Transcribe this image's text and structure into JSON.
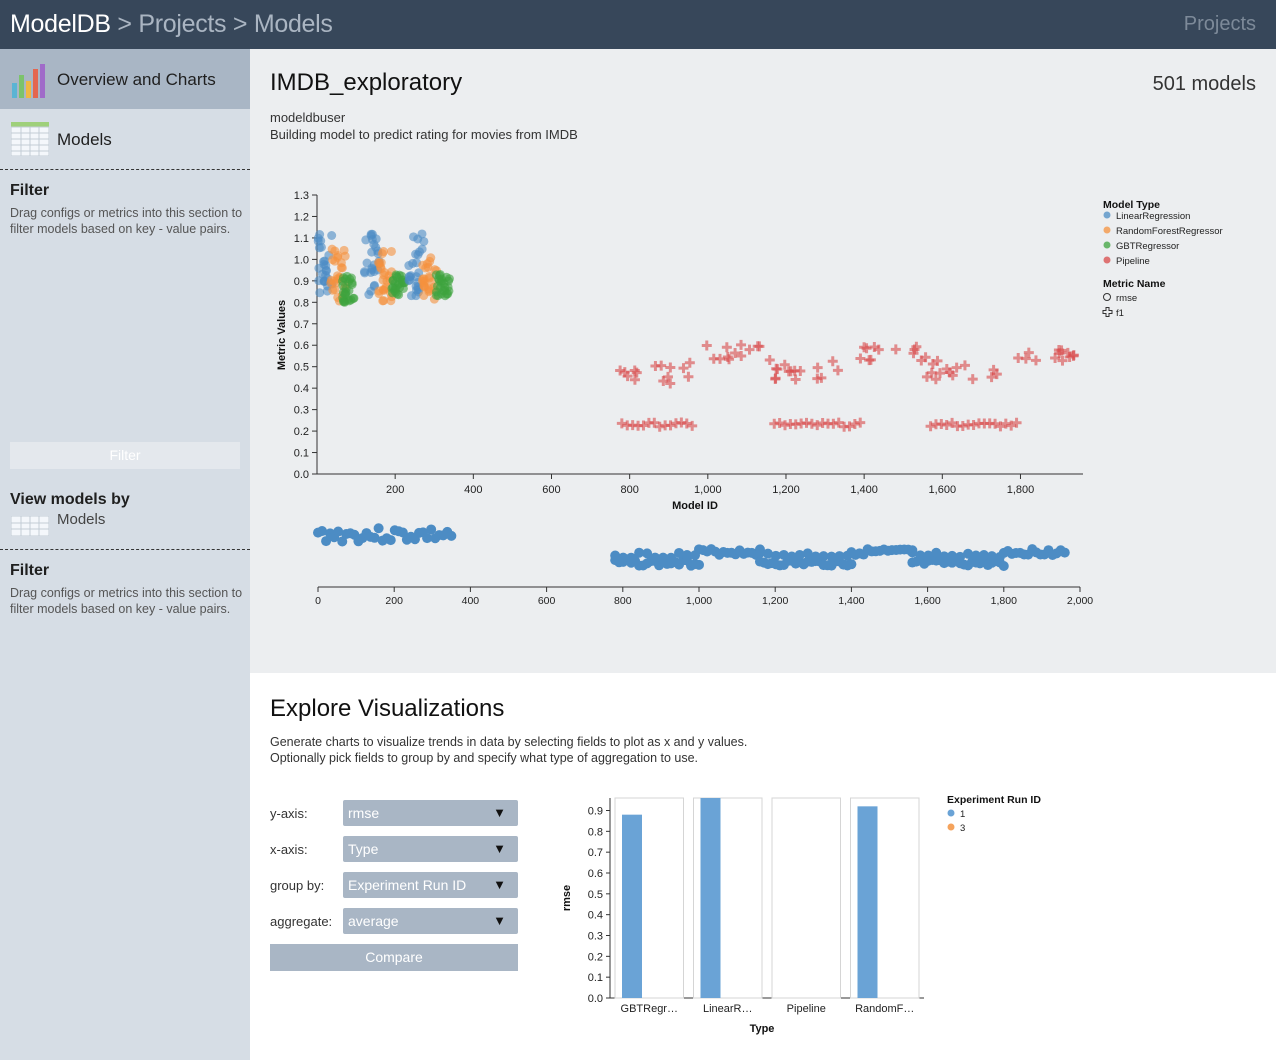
{
  "header": {
    "breadcrumb_home": "ModelDB",
    "breadcrumb_rest": " > Projects > Models",
    "nav_projects": "Projects"
  },
  "sidebar": {
    "nav_overview": "Overview and Charts",
    "nav_models": "Models",
    "filter_heading": "Filter",
    "filter_help": "Drag configs or metrics into this section to filter models based on key - value pairs.",
    "filter_button": "Filter",
    "view_by_heading": "View models by",
    "view_by_option": "Models",
    "filter2_heading": "Filter",
    "filter2_help": "Drag configs or metrics into this section to filter models based on key - value pairs."
  },
  "project": {
    "title": "IMDB_exploratory",
    "model_count": "501 models",
    "owner": "modeldbuser",
    "description": "Building model to predict rating for movies from IMDB"
  },
  "colors": {
    "topbar": "#37475a",
    "LinearRegression": "#4c8cc4",
    "RandomForestRegressor": "#f5913d",
    "GBTRegressor": "#3ea33e",
    "Pipeline": "#d94a4a",
    "bar": "#6aa3d6",
    "run3": "#f5a35c"
  },
  "chart_data": [
    {
      "type": "scatter",
      "title": "",
      "xlabel": "Model ID",
      "ylabel": "Metric Values",
      "xlim": [
        0,
        1960
      ],
      "ylim": [
        0,
        1.3
      ],
      "x_ticks": [
        "200",
        "400",
        "600",
        "800",
        "1,000",
        "1,200",
        "1,400",
        "1,600",
        "1,800"
      ],
      "y_ticks": [
        "0.0",
        "0.1",
        "0.2",
        "0.3",
        "0.4",
        "0.5",
        "0.6",
        "0.7",
        "0.8",
        "0.9",
        "1.0",
        "1.1",
        "1.2",
        "1.3"
      ],
      "legend": {
        "placement": "right",
        "type_title": "Model Type",
        "types": [
          "LinearRegression",
          "RandomForestRegressor",
          "GBTRegressor",
          "Pipeline"
        ],
        "metric_title": "Metric Name",
        "metrics": [
          "rmse",
          "f1"
        ]
      },
      "clusters": [
        {
          "type": "LinearRegression",
          "metric": "rmse",
          "x": [
            0,
            40
          ],
          "y": [
            0.83,
            1.12
          ]
        },
        {
          "type": "RandomForestRegressor",
          "metric": "rmse",
          "x": [
            35,
            75
          ],
          "y": [
            0.8,
            1.05
          ]
        },
        {
          "type": "GBTRegressor",
          "metric": "rmse",
          "x": [
            65,
            100
          ],
          "y": [
            0.8,
            0.93
          ]
        },
        {
          "type": "LinearRegression",
          "metric": "rmse",
          "x": [
            120,
            160
          ],
          "y": [
            0.83,
            1.12
          ]
        },
        {
          "type": "RandomForestRegressor",
          "metric": "rmse",
          "x": [
            155,
            195
          ],
          "y": [
            0.8,
            1.05
          ]
        },
        {
          "type": "GBTRegressor",
          "metric": "rmse",
          "x": [
            190,
            225
          ],
          "y": [
            0.83,
            0.93
          ]
        },
        {
          "type": "LinearRegression",
          "metric": "rmse",
          "x": [
            235,
            275
          ],
          "y": [
            0.83,
            1.12
          ]
        },
        {
          "type": "RandomForestRegressor",
          "metric": "rmse",
          "x": [
            270,
            310
          ],
          "y": [
            0.8,
            1.02
          ]
        },
        {
          "type": "GBTRegressor",
          "metric": "rmse",
          "x": [
            305,
            340
          ],
          "y": [
            0.83,
            0.93
          ]
        },
        {
          "type": "Pipeline",
          "metric": "f1",
          "x": [
            770,
            960
          ],
          "y": [
            0.42,
            0.53
          ]
        },
        {
          "type": "Pipeline",
          "metric": "f1",
          "x": [
            780,
            960
          ],
          "y": [
            0.22,
            0.24
          ]
        },
        {
          "type": "Pipeline",
          "metric": "f1",
          "x": [
            990,
            1160
          ],
          "y": [
            0.52,
            0.62
          ]
        },
        {
          "type": "Pipeline",
          "metric": "f1",
          "x": [
            1160,
            1350
          ],
          "y": [
            0.43,
            0.53
          ]
        },
        {
          "type": "Pipeline",
          "metric": "f1",
          "x": [
            1170,
            1390
          ],
          "y": [
            0.22,
            0.24
          ]
        },
        {
          "type": "Pipeline",
          "metric": "f1",
          "x": [
            1390,
            1560
          ],
          "y": [
            0.52,
            0.61
          ]
        },
        {
          "type": "Pipeline",
          "metric": "f1",
          "x": [
            1560,
            1750
          ],
          "y": [
            0.43,
            0.53
          ]
        },
        {
          "type": "Pipeline",
          "metric": "f1",
          "x": [
            1570,
            1790
          ],
          "y": [
            0.22,
            0.24
          ]
        },
        {
          "type": "Pipeline",
          "metric": "f1",
          "x": [
            1790,
            1960
          ],
          "y": [
            0.52,
            0.58
          ]
        }
      ]
    },
    {
      "type": "scatter",
      "title": "",
      "xlabel": "",
      "ylabel": "",
      "xlim": [
        0,
        2000
      ],
      "x_ticks": [
        "0",
        "200",
        "400",
        "600",
        "800",
        "1,000",
        "1,200",
        "1,400",
        "1,600",
        "1,800",
        "2,000"
      ],
      "segments": [
        {
          "x": [
            0,
            350
          ],
          "band": "upper"
        },
        {
          "x": [
            780,
            1000
          ],
          "band": "lower"
        },
        {
          "x": [
            1000,
            1160
          ],
          "band": "upper"
        },
        {
          "x": [
            1160,
            1400
          ],
          "band": "lower"
        },
        {
          "x": [
            1400,
            1560
          ],
          "band": "upper"
        },
        {
          "x": [
            1560,
            1800
          ],
          "band": "lower"
        },
        {
          "x": [
            1800,
            1960
          ],
          "band": "upper"
        }
      ]
    },
    {
      "type": "bar",
      "title": "",
      "xlabel": "Type",
      "ylabel": "rmse",
      "ylim": [
        0,
        0.96
      ],
      "y_ticks": [
        "0.0",
        "0.1",
        "0.2",
        "0.3",
        "0.4",
        "0.5",
        "0.6",
        "0.7",
        "0.8",
        "0.9"
      ],
      "categories": [
        "GBTRegr…",
        "LinearR…",
        "Pipeline",
        "RandomF…"
      ],
      "series": [
        {
          "name": "1",
          "values": [
            0.88,
            0.96,
            0,
            0.92
          ]
        },
        {
          "name": "3",
          "values": [
            0,
            0,
            0,
            0
          ]
        }
      ],
      "legend_title": "Experiment Run ID",
      "legend_placement": "right"
    }
  ],
  "explore": {
    "title": "Explore Visualizations",
    "line1": "Generate charts to visualize trends in data by selecting fields to plot as x and y values.",
    "line2": "Optionally pick fields to group by and specify what type of aggregation to use.",
    "y_label": "y-axis:",
    "y_value": "rmse",
    "x_label": "x-axis:",
    "x_value": "Type",
    "group_label": "group by:",
    "group_value": "Experiment Run ID",
    "agg_label": "aggregate:",
    "agg_value": "average",
    "dropdown_glyph": "▼",
    "compare_button": "Compare"
  }
}
